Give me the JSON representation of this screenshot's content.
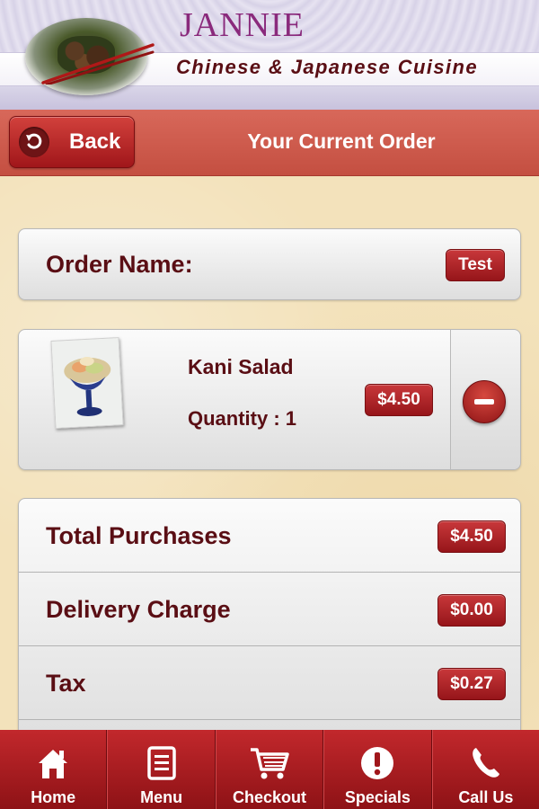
{
  "brand": {
    "name": "JANNIE",
    "subtitle": "Chinese & Japanese Cuisine"
  },
  "titlebar": {
    "back_label": "Back",
    "title": "Your Current Order"
  },
  "order": {
    "name_label": "Order Name:",
    "name_value": "Test"
  },
  "items": [
    {
      "name": "Kani Salad",
      "quantity": "Quantity : 1",
      "price": "$4.50"
    }
  ],
  "totals": [
    {
      "label": "Total Purchases",
      "value": "$4.50"
    },
    {
      "label": "Delivery Charge",
      "value": "$0.00"
    },
    {
      "label": "Tax",
      "value": "$0.27"
    }
  ],
  "nav": [
    {
      "label": "Home",
      "icon": "home-icon"
    },
    {
      "label": "Menu",
      "icon": "menu-icon"
    },
    {
      "label": "Checkout",
      "icon": "cart-icon"
    },
    {
      "label": "Specials",
      "icon": "exclamation-icon"
    },
    {
      "label": "Call Us",
      "icon": "phone-icon"
    }
  ],
  "colors": {
    "accent_red": "#a0161a",
    "title_bar": "#c44f41",
    "text_dark_red": "#5a0e14",
    "brand_purple": "#8a2a7c"
  }
}
